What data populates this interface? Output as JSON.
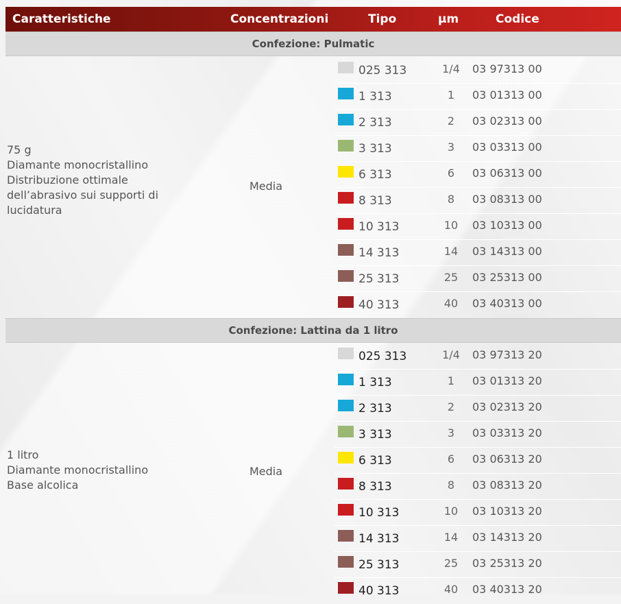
{
  "header": {
    "caratteristiche": "Caratteristiche",
    "concentrazioni": "Concentrazioni",
    "tipo": "Tipo",
    "um": "µm",
    "codice": "Codice"
  },
  "sections": [
    {
      "title": "Confezione: Pulmatic",
      "description": [
        "75 g",
        "Diamante monocristallino",
        "Distribuzione ottimale",
        "dell’abrasivo sui supporti di",
        "lucidatura"
      ],
      "concentration": "Media",
      "rows": [
        {
          "color": "#d8d8d8",
          "tipo": "025 313",
          "um": "1/4",
          "codice": "03 97313 00"
        },
        {
          "color": "#17a8d8",
          "tipo": "1 313",
          "um": "1",
          "codice": "03 01313 00"
        },
        {
          "color": "#17a8d8",
          "tipo": "2 313",
          "um": "2",
          "codice": "03 02313 00"
        },
        {
          "color": "#9bb873",
          "tipo": "3 313",
          "um": "3",
          "codice": "03 03313 00"
        },
        {
          "color": "#ffe600",
          "tipo": "6 313",
          "um": "6",
          "codice": "03 06313 00"
        },
        {
          "color": "#c81c1f",
          "tipo": "8 313",
          "um": "8",
          "codice": "03 08313 00"
        },
        {
          "color": "#c81c1f",
          "tipo": "10 313",
          "um": "10",
          "codice": "03 10313 00"
        },
        {
          "color": "#8d5d58",
          "tipo": "14 313",
          "um": "14",
          "codice": "03 14313 00"
        },
        {
          "color": "#8d5d58",
          "tipo": "25 313",
          "um": "25",
          "codice": "03 25313 00"
        },
        {
          "color": "#9e1f22",
          "tipo": "40 313",
          "um": "40",
          "codice": "03 40313 00"
        }
      ]
    },
    {
      "title": "Confezione: Lattina da 1 litro",
      "description": [
        "1 litro",
        "Diamante monocristallino",
        "Base alcolica"
      ],
      "concentration": "Media",
      "rows": [
        {
          "color": "#d8d8d8",
          "tipo": "025 313",
          "um": "1/4",
          "codice": "03 97313 20"
        },
        {
          "color": "#17a8d8",
          "tipo": "1 313",
          "um": "1",
          "codice": "03 01313 20"
        },
        {
          "color": "#17a8d8",
          "tipo": "2 313",
          "um": "2",
          "codice": "03 02313 20"
        },
        {
          "color": "#9bb873",
          "tipo": "3 313",
          "um": "3",
          "codice": "03 03313 20"
        },
        {
          "color": "#ffe600",
          "tipo": "6 313",
          "um": "6",
          "codice": "03 06313 20"
        },
        {
          "color": "#c81c1f",
          "tipo": "8 313",
          "um": "8",
          "codice": "03 08313 20"
        },
        {
          "color": "#c81c1f",
          "tipo": "10 313",
          "um": "10",
          "codice": "03 10313 20"
        },
        {
          "color": "#8d5d58",
          "tipo": "14 313",
          "um": "14",
          "codice": "03 14313 20"
        },
        {
          "color": "#8d5d58",
          "tipo": "25 313",
          "um": "25",
          "codice": "03 25313 20"
        },
        {
          "color": "#9e1f22",
          "tipo": "40 313",
          "um": "40",
          "codice": "03 40313 20"
        }
      ]
    }
  ]
}
